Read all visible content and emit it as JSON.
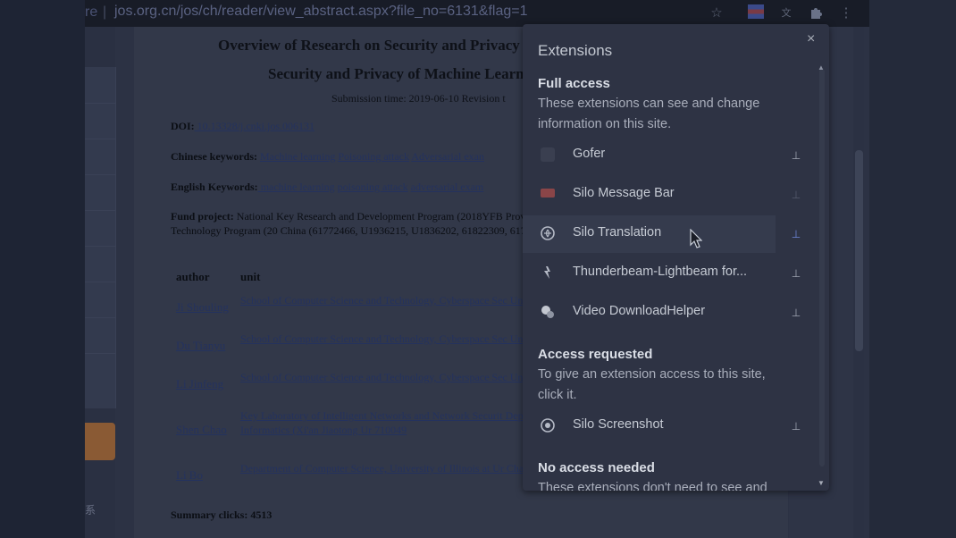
{
  "browser": {
    "url_prefix": "re",
    "url_separator": "|",
    "url": "jos.org.cn/jos/ch/reader/view_abstract.aspx?file_no=6131&flag=1",
    "icons": [
      "star-icon",
      "flag-icon",
      "translate-icon",
      "puzzle-icon",
      "menu-icon"
    ]
  },
  "sidebar": {
    "glyph": "系"
  },
  "article": {
    "title_line1": "Overview of Research on Security and Privacy",
    "title_line2": "Security and Privacy of Machine Learn",
    "submission": "Submission time: 2019-06-10   Revision t",
    "doi_label": "DOI:",
    "doi_value": " 10.13328/j.cnki.jos.006131",
    "cn_keywords_label": "Chinese keywords:",
    "cn_keywords": [
      " Machine learning",
      " Poisoning attack",
      " Adversarial exan"
    ],
    "en_keywords_label": "English Keywords:",
    "en_keywords": [
      " machine learning",
      " poisoning attack",
      " adversarial exam"
    ],
    "fund_label": "Fund project:",
    "fund_text": " National Key Research and Development Program (2018YFB Province (LR19F020003); Zhejiang Science and Technology Program (20 China (61772466, U1936215, U1836202, 61822309, 6173310, U1736205)",
    "table_headers": [
      "author",
      "unit"
    ],
    "authors": [
      {
        "name": "Ji Shouling",
        "unit": "School of Computer Science and Technology, Cyberspace Sec University, Hangzhou, Zhejiang 310027"
      },
      {
        "name": "Du Tianyu",
        "unit": "School of Computer Science and Technology, Cyberspace Sec University, Hangzhou, Zhejiang 310027"
      },
      {
        "name": "Li Jinfeng",
        "unit": "School of Computer Science and Technology, Cyberspace Sec University, Hangzhou, Zhejiang 310027"
      },
      {
        "name": "Shen Chao",
        "unit": "Key Laboratory of Intelligent Networks and Network Securit Department of Electronics and Informatics (Xi'an Jiaotong Ur 710049"
      },
      {
        "name": "Li Bo",
        "unit": "Department of Computer Science, University of Illinois at Ur Champaign, IL 61822, USA"
      }
    ],
    "summary": "Summary clicks: 4513"
  },
  "extensions_popup": {
    "title": "Extensions",
    "close": "×",
    "full_access_title": "Full access",
    "full_access_desc": "These extensions can see and change information on this site.",
    "full_access_items": [
      {
        "name": "Gofer",
        "icon": "gofer-icon",
        "pinned": true
      },
      {
        "name": "Silo Message Bar",
        "icon": "silo-message-bar-icon",
        "pinned": false
      },
      {
        "name": "Silo Translation",
        "icon": "silo-translation-icon",
        "pinned": true
      },
      {
        "name": "Thunderbeam-Lightbeam for...",
        "icon": "thunderbeam-icon",
        "pinned": true
      },
      {
        "name": "Video DownloadHelper",
        "icon": "video-downloadhelper-icon",
        "pinned": true
      }
    ],
    "access_requested_title": "Access requested",
    "access_requested_desc": "To give an extension access to this site, click it.",
    "access_requested_items": [
      {
        "name": "Silo Screenshot",
        "icon": "silo-screenshot-icon",
        "pinned": true
      }
    ],
    "no_access_title": "No access needed",
    "no_access_desc": "These extensions don't need to see and"
  },
  "colors": {
    "popup_bg": "#2e3344",
    "active_pin": "#6d86d8",
    "overlay_dim": "#232836"
  }
}
